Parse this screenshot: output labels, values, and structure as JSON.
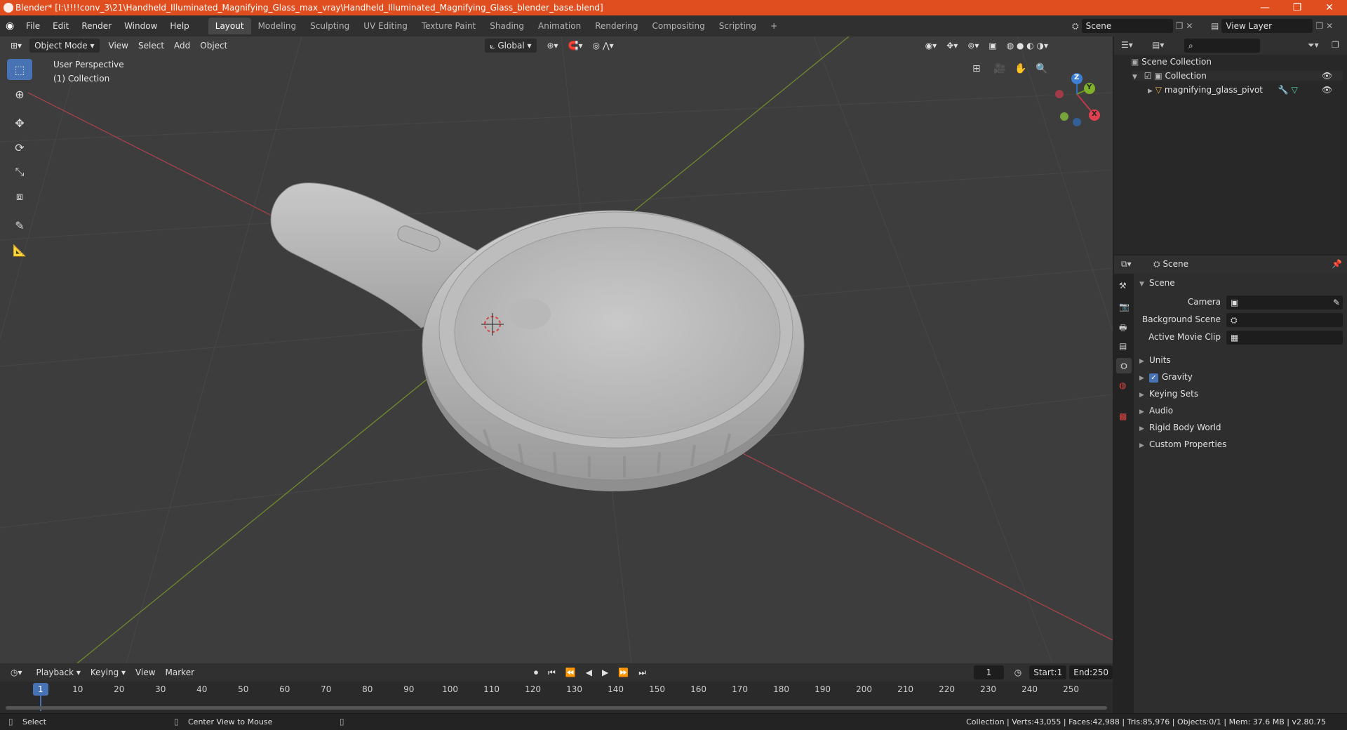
{
  "window": {
    "title": "Blender* [I:\\!!!!conv_3\\21\\Handheld_Illuminated_Magnifying_Glass_max_vray\\Handheld_Illuminated_Magnifying_Glass_blender_base.blend]",
    "minimize": "—",
    "maximize": "❐",
    "close": "✕"
  },
  "menus": [
    "File",
    "Edit",
    "Render",
    "Window",
    "Help"
  ],
  "workspaces": [
    "Layout",
    "Modeling",
    "Sculpting",
    "UV Editing",
    "Texture Paint",
    "Shading",
    "Animation",
    "Rendering",
    "Compositing",
    "Scripting"
  ],
  "active_workspace": "Layout",
  "add_workspace": "+",
  "scene_field": "Scene",
  "view_layer_field": "View Layer",
  "viewport": {
    "mode": "Object Mode",
    "menus": [
      "View",
      "Select",
      "Add",
      "Object"
    ],
    "orientation": "Global",
    "overlay_line1": "User Perspective",
    "overlay_line2": "(1) Collection",
    "gizmo": {
      "x": "X",
      "y": "Y",
      "z": "Z"
    }
  },
  "outliner": {
    "root": "Scene Collection",
    "collection": "Collection",
    "object": "magnifying_glass_pivot"
  },
  "properties": {
    "context": "Scene",
    "section": "Scene",
    "camera_label": "Camera",
    "background_label": "Background Scene",
    "movie_clip_label": "Active Movie Clip",
    "panels": [
      "Units",
      "Gravity",
      "Keying Sets",
      "Audio",
      "Rigid Body World",
      "Custom Properties"
    ]
  },
  "timeline": {
    "menus": [
      "Playback",
      "Keying",
      "View",
      "Marker"
    ],
    "current_frame": "1",
    "start_label": "Start:",
    "start": "1",
    "end_label": "End:",
    "end": "250",
    "ticks": [
      "1",
      "10",
      "20",
      "30",
      "40",
      "50",
      "60",
      "70",
      "80",
      "90",
      "100",
      "110",
      "120",
      "130",
      "140",
      "150",
      "160",
      "170",
      "180",
      "190",
      "200",
      "210",
      "220",
      "230",
      "240",
      "250"
    ]
  },
  "status": {
    "left": "Select",
    "middle": "Center View to Mouse",
    "right": "Collection | Verts:43,055 | Faces:42,988 | Tris:85,976 | Objects:0/1 | Mem: 37.6 MB | v2.80.75"
  }
}
